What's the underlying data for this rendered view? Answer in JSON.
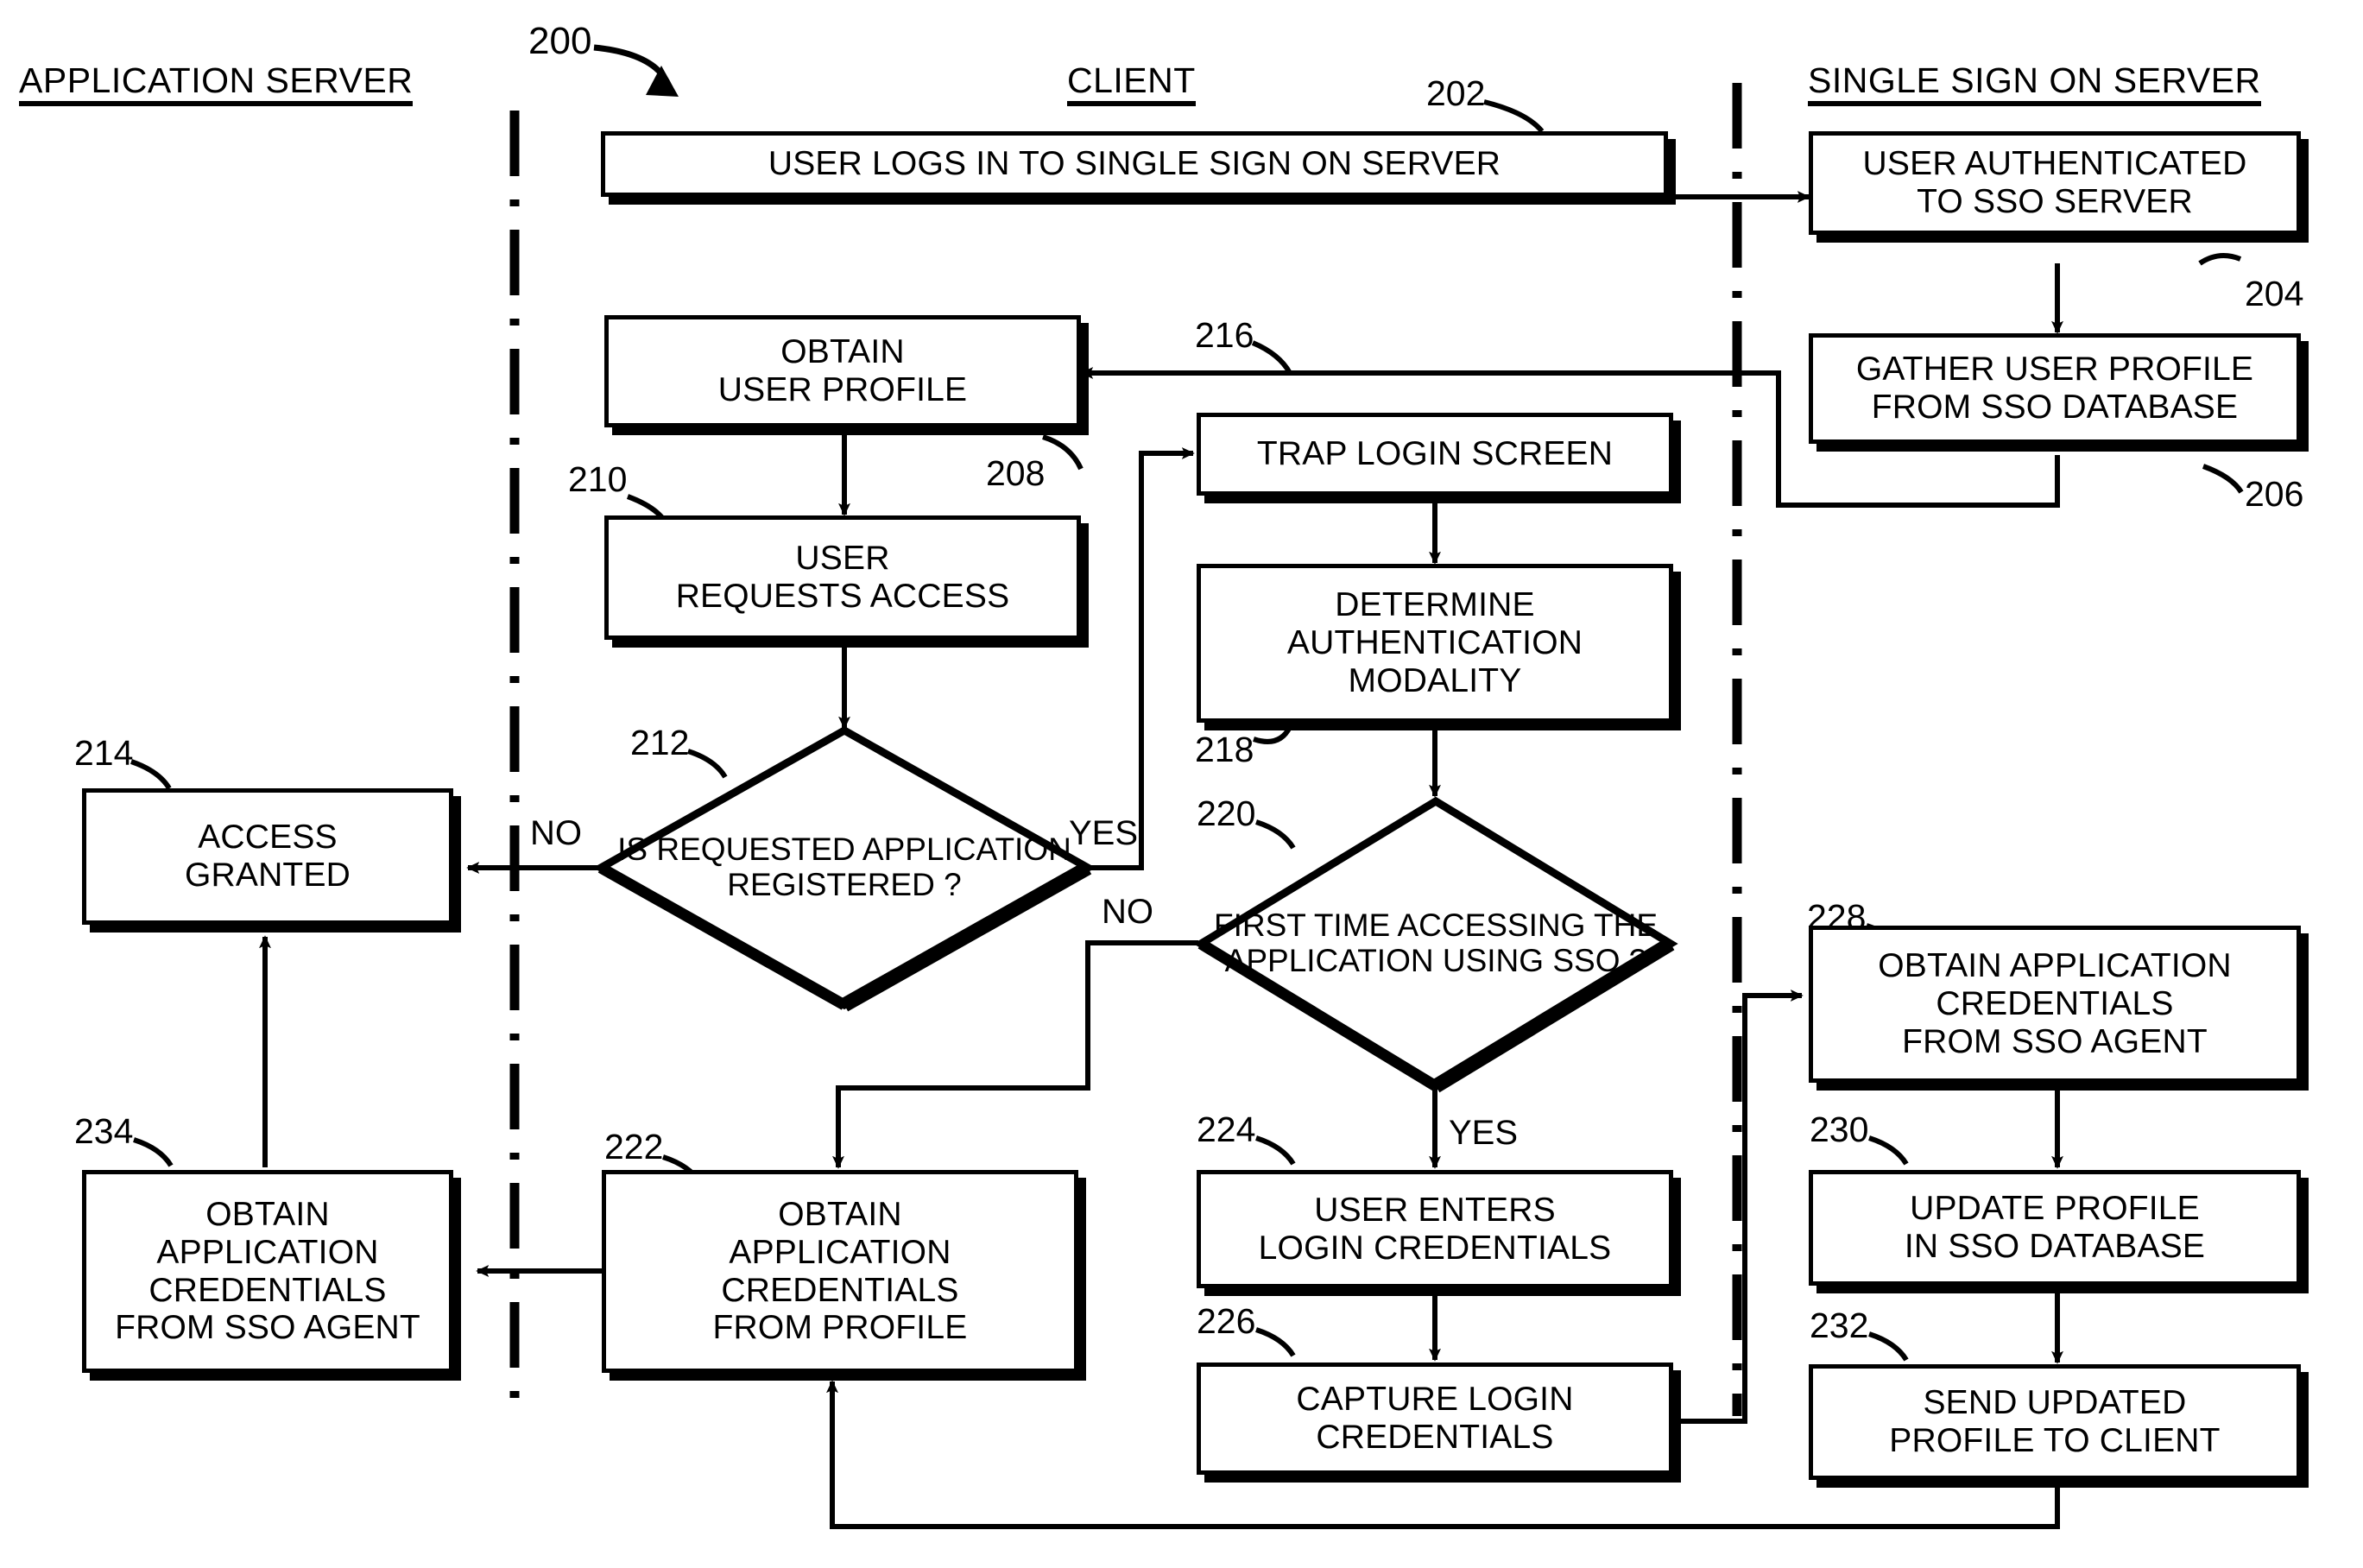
{
  "figure": {
    "number": "200",
    "columns": [
      {
        "id": "application-server",
        "label": "APPLICATION SERVER"
      },
      {
        "id": "client",
        "label": "CLIENT"
      },
      {
        "id": "single-sign-on-server",
        "label": "SINGLE SIGN ON SERVER"
      }
    ]
  },
  "nodes": {
    "n202": {
      "ref": "202",
      "type": "process",
      "lane": "client",
      "text": [
        "USER LOGS IN TO SINGLE SIGN ON SERVER"
      ]
    },
    "n204": {
      "ref": "204",
      "type": "process",
      "lane": "single-sign-on-server",
      "text": [
        "USER AUTHENTICATED",
        "TO SSO SERVER"
      ]
    },
    "n206": {
      "ref": "206",
      "type": "process",
      "lane": "single-sign-on-server",
      "text": [
        "GATHER USER PROFILE",
        "FROM SSO DATABASE"
      ]
    },
    "n208": {
      "ref": "208",
      "type": "process",
      "lane": "client",
      "text": [
        "OBTAIN",
        "USER PROFILE"
      ]
    },
    "n210": {
      "ref": "210",
      "type": "process",
      "lane": "client",
      "text": [
        "USER",
        "REQUESTS ACCESS"
      ]
    },
    "n212": {
      "ref": "212",
      "type": "decision",
      "lane": "client",
      "text": [
        "IS",
        "REQUESTED",
        "APPLICATION",
        "REGISTERED",
        "?"
      ]
    },
    "n214": {
      "ref": "214",
      "type": "process",
      "lane": "application-server",
      "text": [
        "ACCESS",
        "GRANTED"
      ]
    },
    "n216": {
      "ref": "216",
      "type": "process",
      "lane": "client",
      "text": [
        "TRAP LOGIN SCREEN"
      ]
    },
    "n218": {
      "ref": "218",
      "type": "process",
      "lane": "client",
      "text": [
        "DETERMINE",
        "AUTHENTICATION",
        "MODALITY"
      ]
    },
    "n220": {
      "ref": "220",
      "type": "decision",
      "lane": "client",
      "text": [
        "FIRST",
        "TIME ACCESSING",
        "THE APPLICATION",
        "USING SSO",
        "?"
      ]
    },
    "n222": {
      "ref": "222",
      "type": "process",
      "lane": "client",
      "text": [
        "OBTAIN",
        "APPLICATION",
        "CREDENTIALS",
        "FROM PROFILE"
      ]
    },
    "n224": {
      "ref": "224",
      "type": "process",
      "lane": "client",
      "text": [
        "USER ENTERS",
        "LOGIN CREDENTIALS"
      ]
    },
    "n226": {
      "ref": "226",
      "type": "process",
      "lane": "client",
      "text": [
        "CAPTURE LOGIN",
        "CREDENTIALS"
      ]
    },
    "n228": {
      "ref": "228",
      "type": "process",
      "lane": "single-sign-on-server",
      "text": [
        "OBTAIN APPLICATION",
        "CREDENTIALS",
        "FROM SSO AGENT"
      ]
    },
    "n230": {
      "ref": "230",
      "type": "process",
      "lane": "single-sign-on-server",
      "text": [
        "UPDATE PROFILE",
        "IN SSO DATABASE"
      ]
    },
    "n232": {
      "ref": "232",
      "type": "process",
      "lane": "single-sign-on-server",
      "text": [
        "SEND UPDATED",
        "PROFILE TO CLIENT"
      ]
    },
    "n234": {
      "ref": "234",
      "type": "process",
      "lane": "application-server",
      "text": [
        "OBTAIN",
        "APPLICATION",
        "CREDENTIALS",
        "FROM SSO AGENT"
      ]
    }
  },
  "edge_labels": {
    "d212_no": "NO",
    "d212_yes": "YES",
    "d220_no": "NO",
    "d220_yes": "YES"
  },
  "colors": {
    "ink": "#000000",
    "paper": "#ffffff"
  }
}
